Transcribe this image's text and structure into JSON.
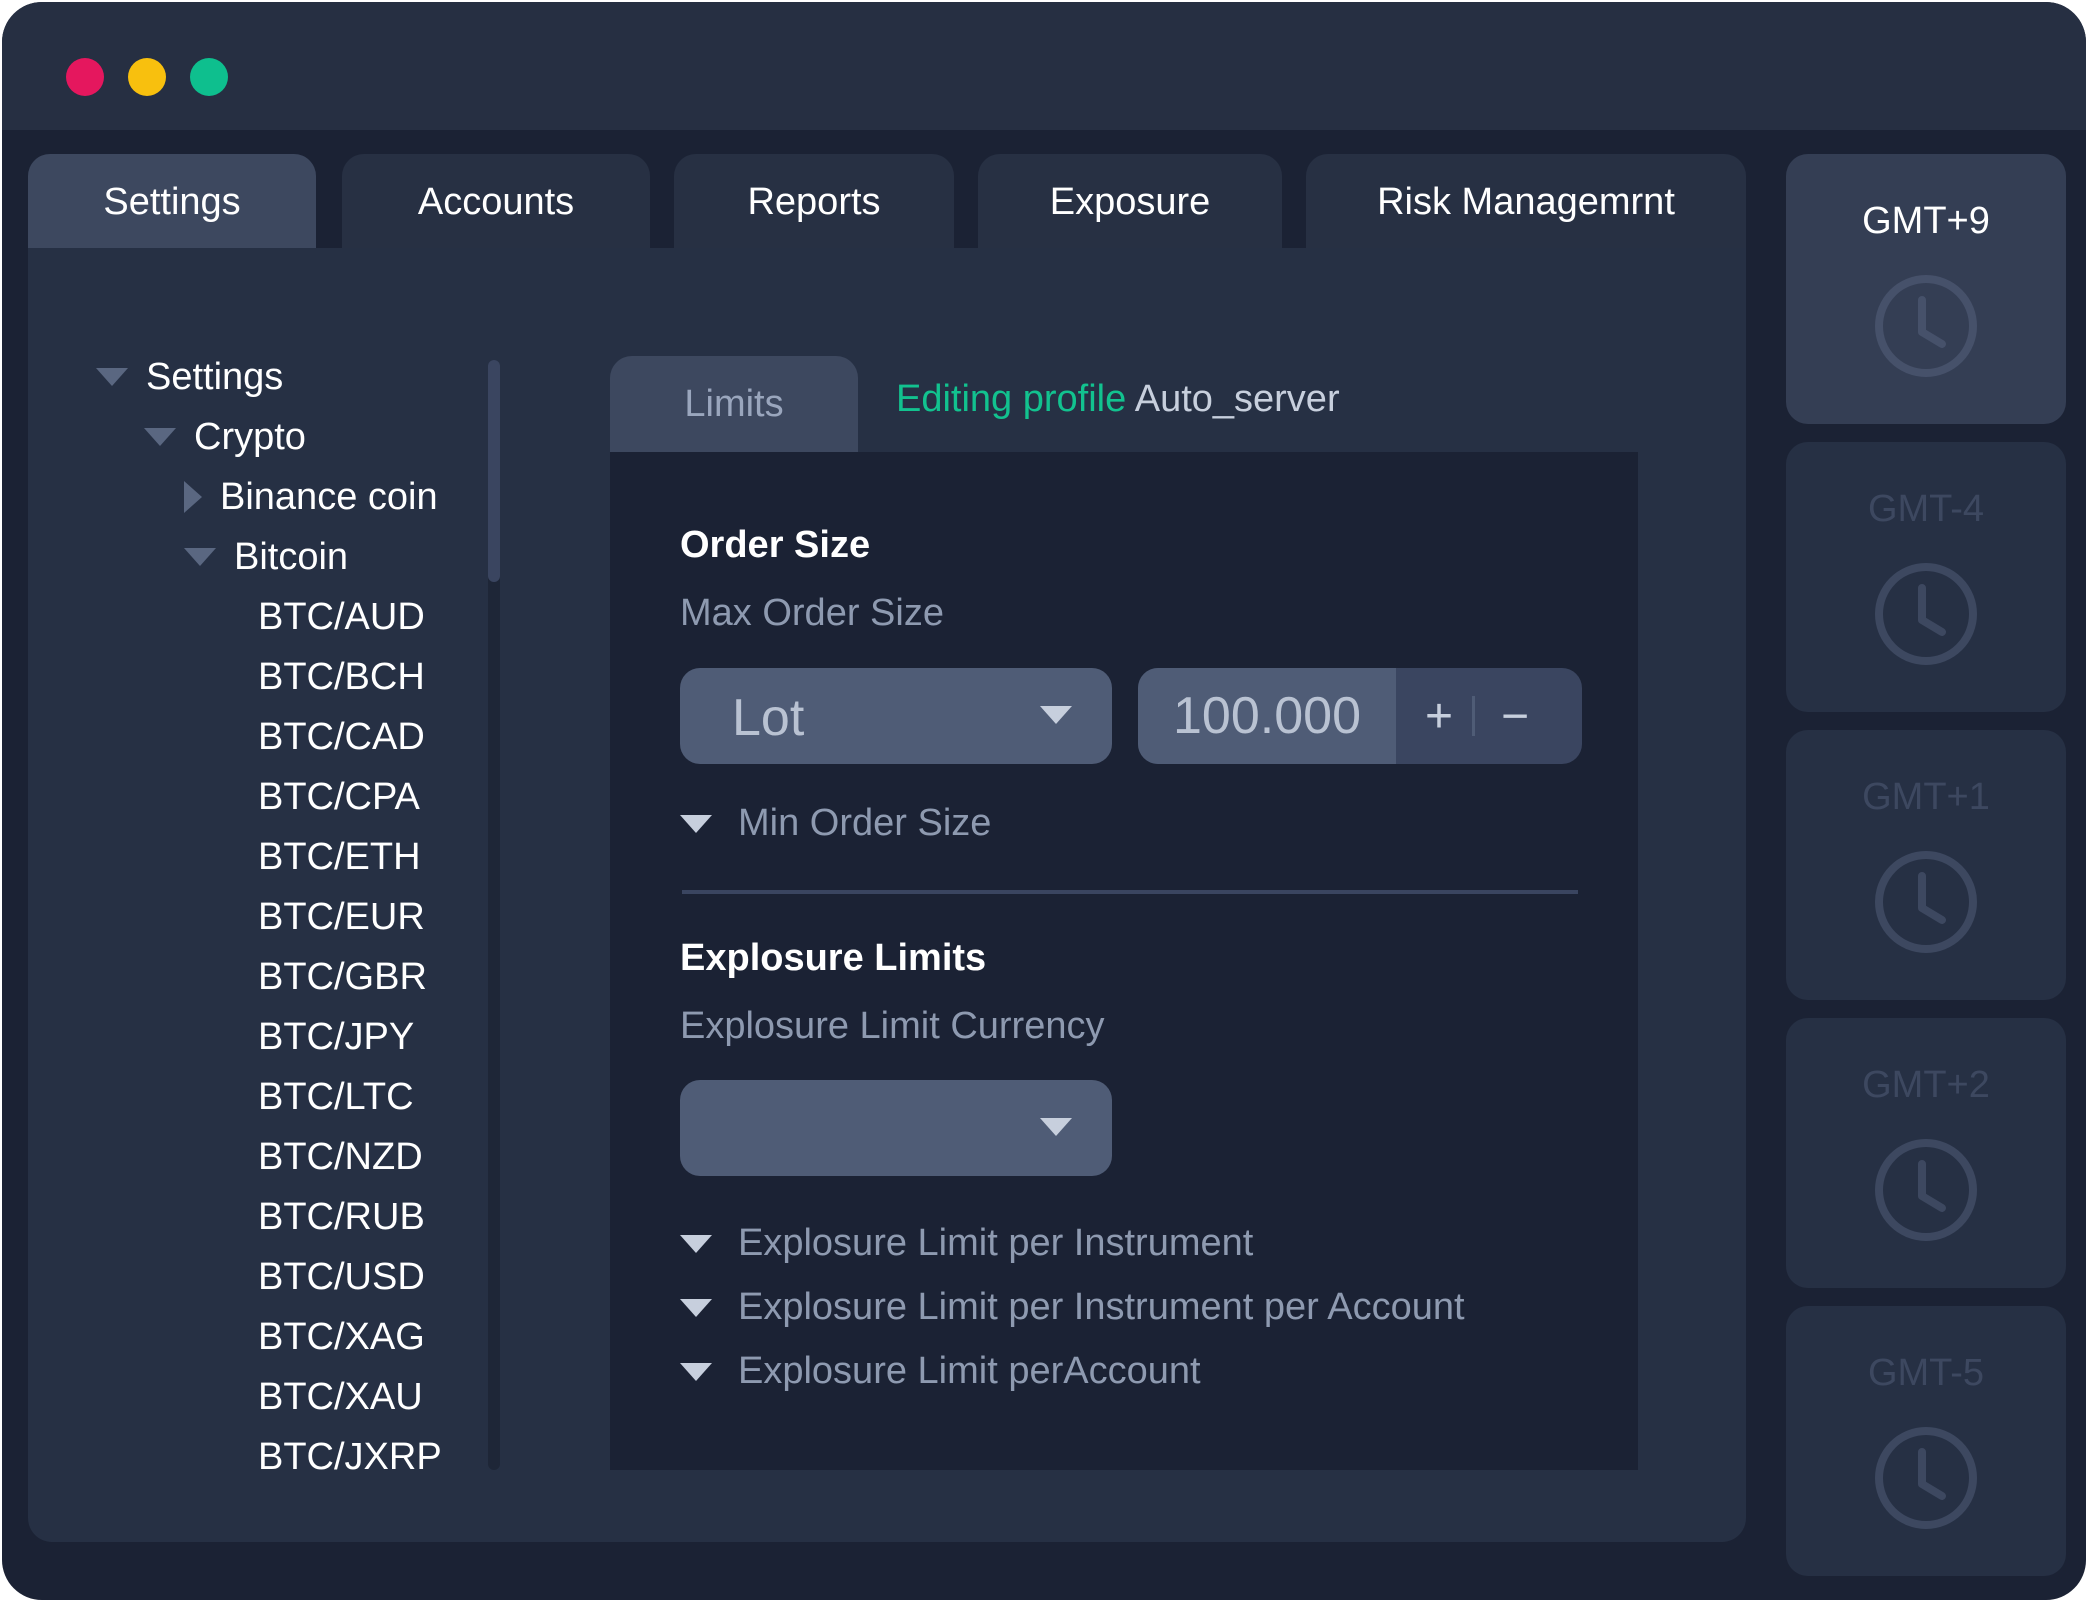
{
  "tabs": [
    {
      "label": "Settings",
      "active": true
    },
    {
      "label": "Accounts",
      "active": false
    },
    {
      "label": "Reports",
      "active": false
    },
    {
      "label": "Exposure",
      "active": false
    },
    {
      "label": "Risk Managemrnt",
      "active": false
    }
  ],
  "tree": {
    "root": "Settings",
    "crypto": "Crypto",
    "binance": "Binance coin",
    "bitcoin": "Bitcoin",
    "pairs": [
      "BTC/AUD",
      "BTC/BCH",
      "BTC/CAD",
      "BTC/CPA",
      "BTC/ETH",
      "BTC/EUR",
      "BTC/GBR",
      "BTC/JPY",
      "BTC/LTC",
      "BTC/NZD",
      "BTC/RUB",
      "BTC/USD",
      "BTC/XAG",
      "BTC/XAU",
      "BTC/JXRP"
    ]
  },
  "subtab": {
    "label": "Limits"
  },
  "editing": {
    "prefix": "Editing profile",
    "profile": "Auto_server"
  },
  "order_size": {
    "title": "Order Size",
    "max_label": "Max Order Size",
    "unit_select": "Lot",
    "amount": "100.000",
    "plus": "+",
    "minus": "−",
    "min_label": "Min Order Size"
  },
  "exposure": {
    "title": "Explosure Limits",
    "currency_label": "Explosure Limit Currency",
    "currency_value": "",
    "per_instrument": "Explosure Limit per Instrument",
    "per_instrument_account": "Explosure Limit per Instrument per Account",
    "per_account": "Explosure Limit perAccount"
  },
  "timezones": [
    {
      "label": "GMT+9",
      "active": true
    },
    {
      "label": "GMT-4",
      "active": false
    },
    {
      "label": "GMT+1",
      "active": false
    },
    {
      "label": "GMT+2",
      "active": false
    },
    {
      "label": "GMT-5",
      "active": false
    }
  ],
  "colors": {
    "accent_green": "#12c28f",
    "dot_red": "#e5175e",
    "dot_yellow": "#f8c00e",
    "dot_green": "#0ebf8e"
  },
  "icons": [
    "clock-icon",
    "caret-down-icon",
    "caret-right-icon",
    "dropdown-arrow-icon"
  ]
}
